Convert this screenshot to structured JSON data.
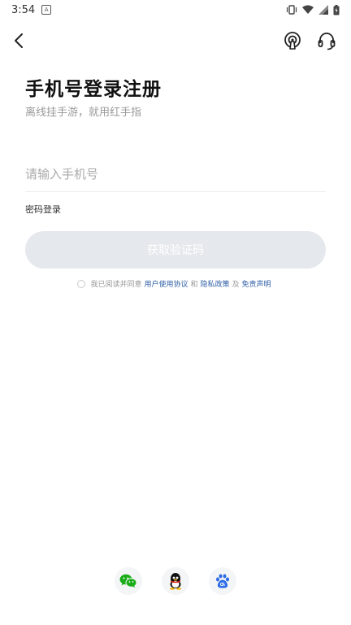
{
  "status_bar": {
    "time": "3:54",
    "badge": "A"
  },
  "header": {
    "title": "手机号登录注册",
    "subtitle": "离线挂手游，就用红手指"
  },
  "form": {
    "phone_placeholder": "请输入手机号",
    "password_login_label": "密码登录",
    "get_code_label": "获取验证码"
  },
  "agreement": {
    "prefix": "我已阅读并同意",
    "user_agreement": "用户使用协议",
    "and": "和",
    "privacy_policy": "隐私政策",
    "conj": "及",
    "disclaimer": "免责声明"
  },
  "colors": {
    "link": "#2f5fa6",
    "button_disabled": "#e5e8ec",
    "wechat": "#1aad19",
    "baidu": "#2e6be6"
  },
  "social_login": [
    "wechat-icon",
    "qq-icon",
    "baidu-icon"
  ]
}
